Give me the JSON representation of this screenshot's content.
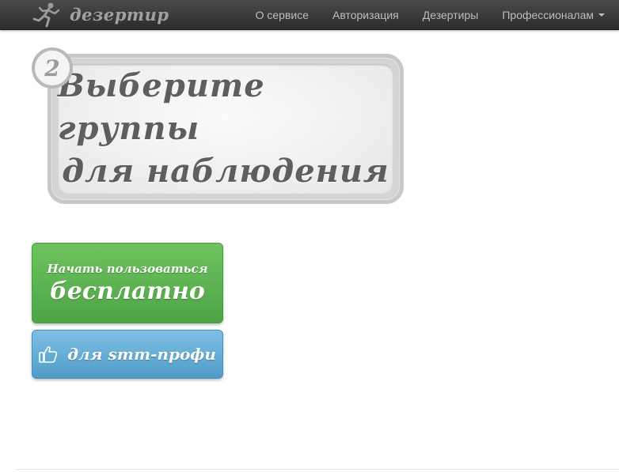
{
  "navbar": {
    "brand": "дезертир",
    "brand_icon": "running-man-icon",
    "links": [
      {
        "label": "О сервисе"
      },
      {
        "label": "Авторизация"
      },
      {
        "label": "Дезертиры"
      },
      {
        "label": "Профессионалам",
        "dropdown": true
      }
    ]
  },
  "step": {
    "number": "2",
    "line1": "Выберите группы",
    "line2": "для наблюдения"
  },
  "buttons": {
    "free": {
      "line1": "Начать пользоваться",
      "line2": "бесплатно",
      "color": "#5cb85c"
    },
    "pro": {
      "label": "для smm-профи",
      "icon": "thumbs-up-icon",
      "color": "#5aa9d6"
    }
  },
  "colors": {
    "navbar_bg": "#3a3a3a",
    "nav_text": "#bdbdbd",
    "step_text": "#5e5e5e"
  }
}
